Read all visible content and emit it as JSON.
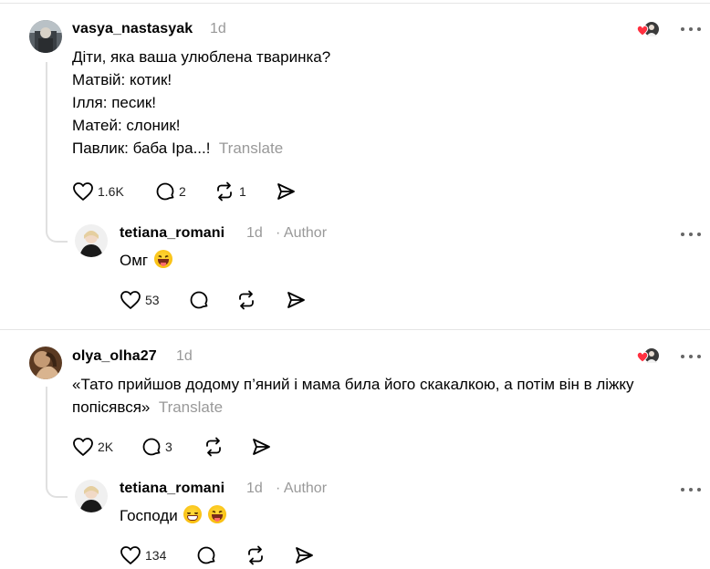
{
  "threads": [
    {
      "post": {
        "username": "vasya_nastasyak",
        "time": "1d",
        "lines": [
          "Діти, яка ваша улюблена тваринка?",
          "Матвій: котик!",
          "Ілля: песик!",
          "Матей: слоник!",
          "Павлик: баба Іра...!"
        ],
        "translate_label": "Translate",
        "likes": "1.6K",
        "replies": "2",
        "reposts": "1",
        "avatar_icon": "profile-photo"
      },
      "reply": {
        "username": "tetiana_romani",
        "time": "1d",
        "author_label": "· Author",
        "text": "Омг",
        "emojis": [
          "squinting-tongue-emoji"
        ],
        "likes": "53",
        "avatar_icon": "profile-photo"
      }
    },
    {
      "post": {
        "username": "olya_olha27",
        "time": "1d",
        "lines": [
          "«Тато прийшов додому п’яний і мама била його скакалкою, а потім він в ліжку",
          "попісявся»"
        ],
        "translate_label": "Translate",
        "likes": "2K",
        "replies": "3",
        "reposts": "",
        "avatar_icon": "profile-photo"
      },
      "reply": {
        "username": "tetiana_romani",
        "time": "1d",
        "author_label": "· Author",
        "text": "Господи",
        "emojis": [
          "grimacing-emoji",
          "squinting-tongue-emoji"
        ],
        "likes": "134",
        "avatar_icon": "profile-photo"
      }
    }
  ],
  "colors": {
    "muted": "#999999",
    "liked_heart": "#ff3040",
    "divider": "#e5e5e5"
  },
  "icons": {
    "like": "heart-icon",
    "reply": "speech-bubble-icon",
    "repost": "repost-icon",
    "share": "send-icon",
    "more": "more-horizontal-icon",
    "liked_by": "liked-by-author-icon"
  }
}
